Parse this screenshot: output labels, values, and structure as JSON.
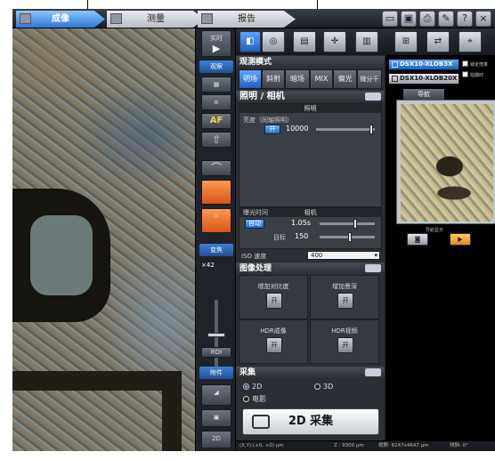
{
  "tabs": [
    {
      "label": "成像"
    },
    {
      "label": "测量"
    },
    {
      "label": "报告"
    }
  ],
  "top_icons": [
    "?",
    "×"
  ],
  "left_toolbar": {
    "live_label": "实时",
    "live_sub": "观察",
    "zoom_header": "变焦",
    "zoom_value": "×42",
    "zoom_btn": "ROI",
    "tools_header": "附件",
    "af_label": "AF",
    "btn_2d": "2D"
  },
  "panel": {
    "observation_title": "观测模式",
    "modes": [
      "明场",
      "斜射",
      "暗场",
      "MIX",
      "偏光",
      "微分干"
    ],
    "active_mode": 0,
    "lighting_title": "照明 / 相机",
    "lighting_sub": "照明",
    "brightness_label": "亮度（同轴照明）",
    "brightness_btn": "开",
    "brightness_value": "10000",
    "camera_sub": "相机",
    "exposure_label": "曝光时间",
    "exposure_btn": "自动",
    "exposure_value": "1.05s",
    "target_label": "目标",
    "target_value": "150",
    "iso_label": "ISO 速度",
    "iso_value": "400",
    "image_proc_title": "图像处理",
    "ip_cells": [
      {
        "label": "增加对比度",
        "btn": "开"
      },
      {
        "label": "增加景深",
        "btn": "开"
      },
      {
        "label": "HDR成像",
        "btn": "开"
      },
      {
        "label": "HDR视频",
        "btn": "开"
      }
    ],
    "capture_title": "采集",
    "radio_2d": "2D",
    "radio_3d": "3D",
    "radio_movie": "电影",
    "capture_btn": "2D 采集"
  },
  "right_panel": {
    "device_a": "DSX10-XLOB3X",
    "device_b": "DSX10-XLOB20X",
    "chk_a": "锁定倍率",
    "chk_b": "拍摄时",
    "nav_tab": "导航",
    "nav_label": "导航显示"
  },
  "status": {
    "xy": "(X,Y):(+0, +0) μm",
    "z": "Z : 9300 μm",
    "fov": "视野: 6247x4647 μm",
    "angle": "倾斜: 0°"
  }
}
